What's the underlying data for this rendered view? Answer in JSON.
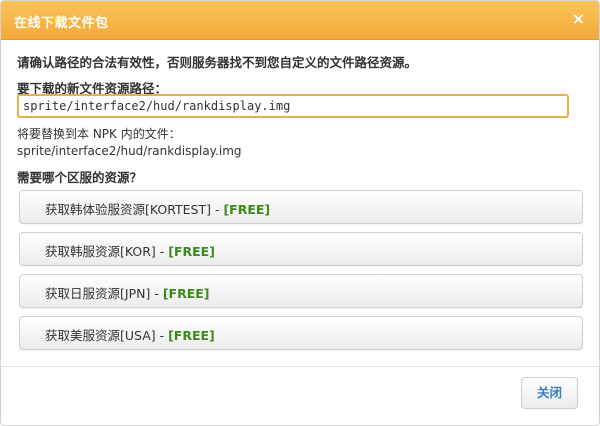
{
  "dialog": {
    "title": "在线下载文件包",
    "close_symbol": "×"
  },
  "body": {
    "warning": "请确认路径的合法有效性，否则服务器找不到您自定义的文件路径资源。",
    "path_label": "要下载的新文件资源路径：",
    "path_input_value": "sprite/interface2/hud/rankdisplay.img",
    "replace_label": "将要替换到本 NPK 内的文件：",
    "replace_path": "sprite/interface2/hud/rankdisplay.img",
    "region_label": "需要哪个区服的资源？"
  },
  "regions": [
    {
      "name": "获取韩体验服资源[KORTEST]",
      "sep": " - ",
      "badge": "[FREE]"
    },
    {
      "name": "获取韩服资源[KOR]",
      "sep": " - ",
      "badge": "[FREE]"
    },
    {
      "name": "获取日服资源[JPN]",
      "sep": " - ",
      "badge": "[FREE]"
    },
    {
      "name": "获取美服资源[USA]",
      "sep": " - ",
      "badge": "[FREE]"
    }
  ],
  "footer": {
    "close_label": "关闭"
  },
  "colors": {
    "titlebar": "#f3a93a",
    "free_badge": "#3a8a1c",
    "close_button_text": "#3a7cc0",
    "input_border": "#e8b04a"
  }
}
